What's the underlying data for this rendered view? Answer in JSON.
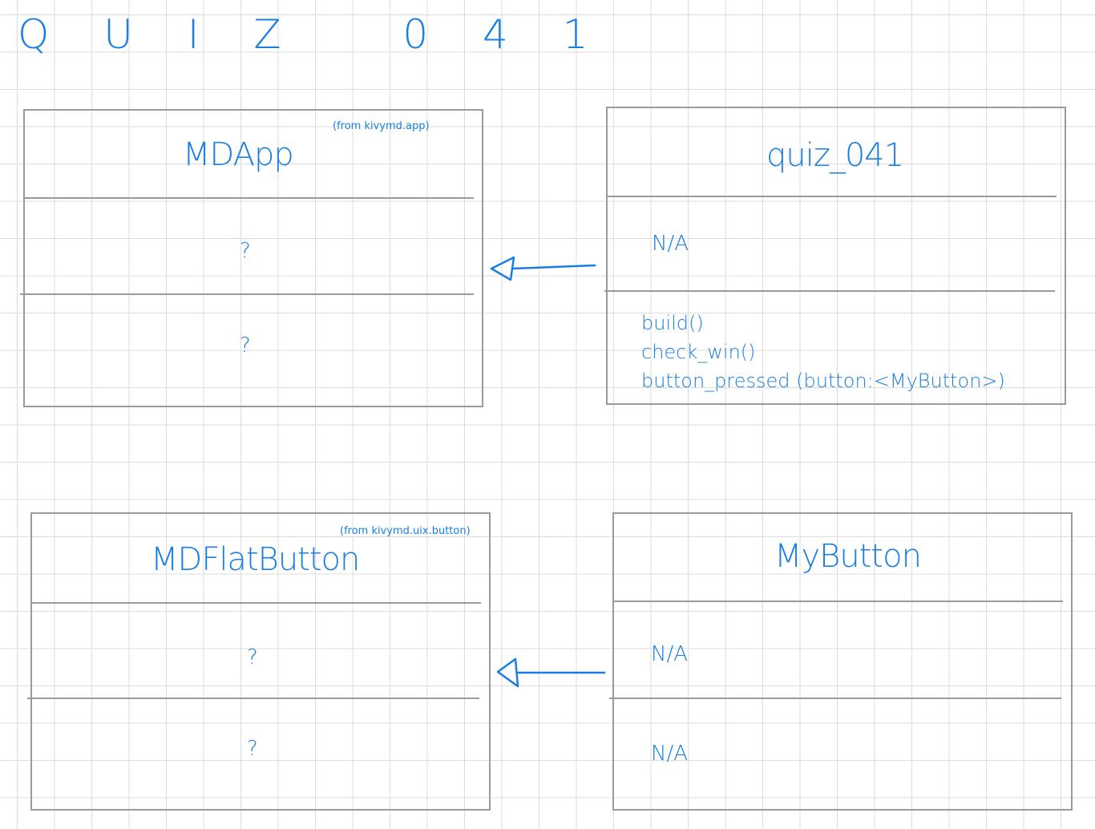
{
  "title": "Q U I Z   0 4 1",
  "classes": {
    "mdapp": {
      "name": "MDApp",
      "from": "(from kivymd.app)",
      "attributes": "?",
      "methods": "?"
    },
    "quiz_041": {
      "name": "quiz_041",
      "attributes": "N/A",
      "methods": [
        "build()",
        "check_win()",
        "button_pressed (button:<MyButton>)"
      ]
    },
    "mdflatbutton": {
      "name": "MDFlatButton",
      "from": "(from kivymd.uix.button)",
      "attributes": "?",
      "methods": "?"
    },
    "mybutton": {
      "name": "MyButton",
      "attributes": "N/A",
      "methods": "N/A"
    }
  },
  "relations": [
    {
      "from": "quiz_041",
      "to": "MDApp",
      "type": "inheritance"
    },
    {
      "from": "MyButton",
      "to": "MDFlatButton",
      "type": "inheritance"
    }
  ],
  "colors": {
    "ink": "#1a7fe0",
    "box": "#9a9a9a",
    "grid": "#dcdcdc"
  }
}
